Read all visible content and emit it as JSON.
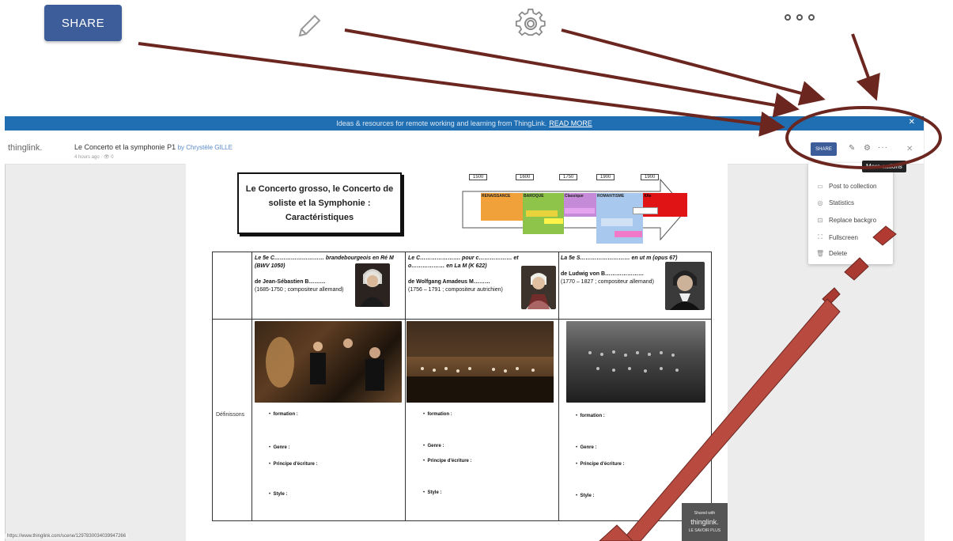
{
  "toolbar": {
    "share_label": "SHARE",
    "edit_icon": "pencil-icon",
    "settings_icon": "gear-icon",
    "more_icon": "more-dots-icon"
  },
  "banner": {
    "text": "Ideas & resources for remote working and learning from ThingLink.",
    "link": "READ MORE"
  },
  "header": {
    "logo": "thinglink.",
    "title": "Le Concerto et la symphonie P1",
    "author": "by Chrystèle GILLE",
    "meta": "4 hours ago · 👁 0",
    "share_label": "SHARE",
    "tooltip": "More actions"
  },
  "menu": {
    "items": [
      {
        "icon": "folder-icon",
        "label": "Post to collection"
      },
      {
        "icon": "stats-icon",
        "label": "Statistics"
      },
      {
        "icon": "image-icon",
        "label": "Replace backgro"
      },
      {
        "icon": "fullscreen-icon",
        "label": "Fullscreen"
      },
      {
        "icon": "trash-icon",
        "label": "Delete"
      }
    ]
  },
  "document": {
    "title_lines": [
      "Le Concerto grosso,  le Concerto de",
      "soliste et la Symphonie :",
      "Caractéristiques"
    ],
    "timeline_years": [
      "1500",
      "1600",
      "1750",
      "1900",
      "1900"
    ],
    "periods": [
      "RENAISSANCE",
      "BAROQUE",
      "Classique",
      "ROMANTISME",
      "XXe"
    ],
    "col1": {
      "heading": "Le 5e C……………………… brandebourgeois en Ré M (BWV 1050)",
      "composer": "de Jean-Sébastien B………",
      "dates": "(1685-1750 ; compositeur allemand)"
    },
    "col2": {
      "heading": "Le C…………………. pour c……………… et o……………… en La M (K 622)",
      "composer": "de Wolfgang Amadeus M………",
      "dates": "(1756 – 1791 ; compositeur autrichien)"
    },
    "col3": {
      "heading": "La 5e S……………………… en ut m (opus 67)",
      "composer": "de Ludwig von B…………………",
      "dates": "(1770 – 1827 ; compositeur allemand)"
    },
    "row_label": "Définissons",
    "bullets": [
      "formation :",
      "Genre :",
      "Principe d'écriture :",
      "Style :"
    ]
  },
  "status_url": "https://www.thinglink.com/scene/1297830034039947266",
  "badge": {
    "line1": "Shared with",
    "line2": "thinglink.",
    "line3": "LE SAVOIR PLUS"
  },
  "colors": {
    "annotation": "#7a2a22",
    "share_blue": "#3d5d9a",
    "banner_blue": "#1f6fb2"
  }
}
